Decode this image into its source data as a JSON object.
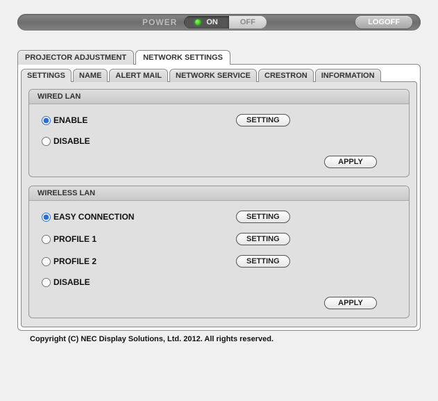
{
  "topbar": {
    "power_label": "POWER",
    "on_label": "ON",
    "off_label": "OFF",
    "logoff_label": "LOGOFF"
  },
  "tabs": {
    "projector": "PROJECTOR ADJUSTMENT",
    "network": "NETWORK SETTINGS"
  },
  "subtabs": {
    "settings": "SETTINGS",
    "name": "NAME",
    "alert_mail": "ALERT MAIL",
    "network_service": "NETWORK SERVICE",
    "crestron": "CRESTRON",
    "information": "INFORMATION"
  },
  "wired": {
    "title": "WIRED LAN",
    "enable": "ENABLE",
    "disable": "DISABLE",
    "setting_btn": "SETTING",
    "apply_btn": "APPLY"
  },
  "wireless": {
    "title": "WIRELESS LAN",
    "easy": "EASY CONNECTION",
    "profile1": "PROFILE 1",
    "profile2": "PROFILE 2",
    "disable": "DISABLE",
    "setting_btn": "SETTING",
    "apply_btn": "APPLY"
  },
  "footer": {
    "copyright": "Copyright (C) NEC Display Solutions, Ltd. 2012. All rights reserved."
  }
}
